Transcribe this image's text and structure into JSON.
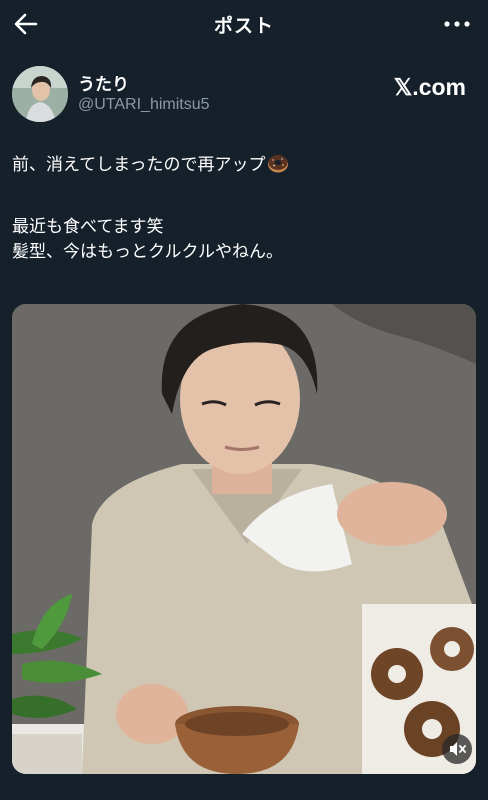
{
  "header": {
    "title": "ポスト",
    "back_icon": "arrow-left-icon",
    "more_icon": "more-horizontal-icon"
  },
  "author": {
    "display_name": "うたり",
    "handle": "@UTARI_himitsu5",
    "source_badge": "𝕏.com"
  },
  "post": {
    "line1": "前、消えてしまったので再アップ",
    "line1_emoji": "doughnut-icon",
    "line2": "最近も食べてます笑",
    "line3": "髪型、今はもっとクルクルやねん。"
  },
  "media": {
    "type": "video",
    "mute_icon": "volume-muted-icon"
  },
  "colors": {
    "background": "#15202b",
    "text": "#ffffff",
    "secondary_text": "#8b98a5"
  }
}
